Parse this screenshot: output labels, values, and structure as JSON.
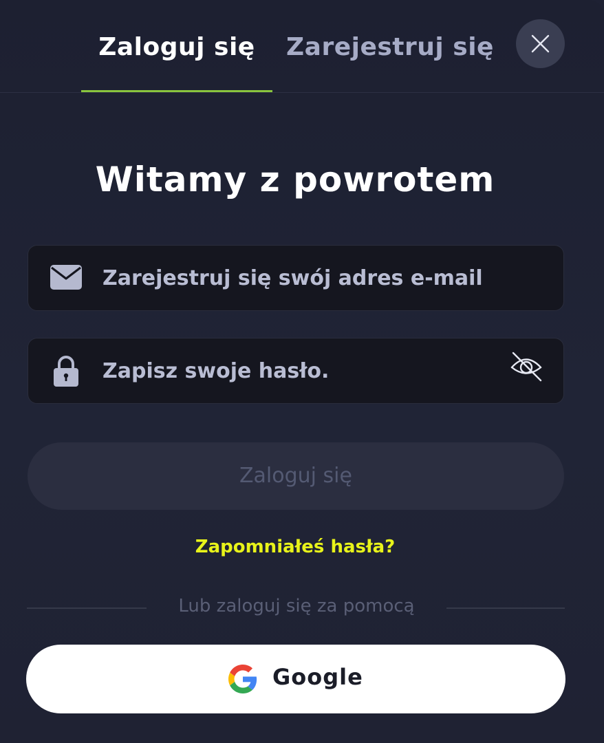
{
  "tabs": {
    "login_label": "Zaloguj się",
    "register_label": "Zarejestruj się",
    "active": "login"
  },
  "close_icon": "close-icon",
  "heading": "Witamy z powrotem",
  "email_field": {
    "icon": "envelope-icon",
    "placeholder": "Zarejestruj się swój adres e-mail",
    "value": ""
  },
  "password_field": {
    "icon": "lock-icon",
    "placeholder": "Zapisz swoje hasło.",
    "value": "",
    "toggle_icon": "eye-slash-icon"
  },
  "submit_label": "Zaloguj się",
  "forgot_label": "Zapomniałeś hasła?",
  "divider_text": "Lub zaloguj się za pomocą",
  "google": {
    "icon": "google-icon",
    "label": "Google"
  },
  "colors": {
    "background": "#1e2133",
    "accent_underline": "#8ac53e",
    "forgot_link": "#e8f31a",
    "input_bg": "#15161f",
    "disabled_button": "#2b2e40"
  }
}
